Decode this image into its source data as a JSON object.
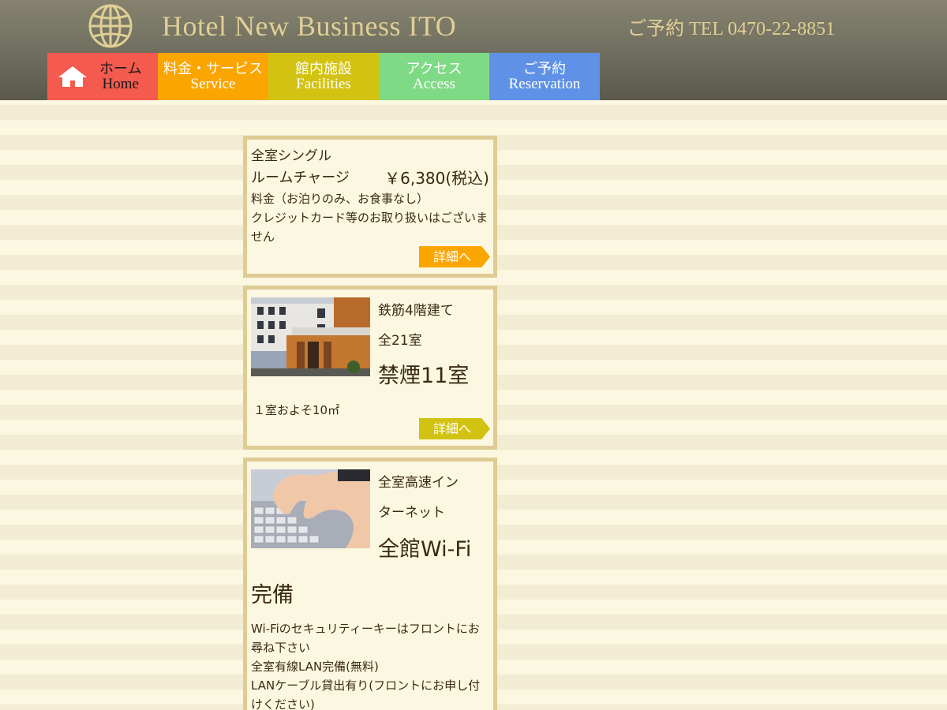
{
  "header": {
    "hotel_name": "Hotel New Business ITO",
    "reservation_tel": "ご予約  TEL 0470-22-8851"
  },
  "nav": [
    {
      "ja": "ホーム",
      "en": "Home"
    },
    {
      "ja": "料金・サービス",
      "en": "Service"
    },
    {
      "ja": "館内施設",
      "en": "Facilities"
    },
    {
      "ja": "アクセス",
      "en": "Access"
    },
    {
      "ja": "ご予約",
      "en": "Reservation"
    }
  ],
  "card1": {
    "line1": "全室シングル",
    "charge_label": "ルームチャージ",
    "price": "￥6,380(税込)",
    "note1": "料金（お泊りのみ、お食事なし）",
    "note2": "クレジットカード等のお取り扱いはございません",
    "button": "詳細へ"
  },
  "card2": {
    "line1": "鉄筋4階建て",
    "line2": "全21室",
    "big": "禁煙11室",
    "size": "１室およそ10㎡",
    "button": "詳細へ"
  },
  "card3": {
    "line1": "全室高速イン",
    "line2": "ターネット",
    "big1": "全館Wi-Fi",
    "big2": "完備",
    "note1": "Wi-Fiのセキュリティーキーはフロントにお尋ね下さい",
    "note2": "全室有線LAN完備(無料)",
    "note3": "LANケーブル貸出有り(フロントにお申し付けください)"
  },
  "colors": {
    "nav_home": "#f55a4e",
    "nav_service": "#fba500",
    "nav_facilities": "#d2c212",
    "nav_access": "#7fda86",
    "nav_reserve": "#5f92e6",
    "card_border": "#dfcc94"
  }
}
